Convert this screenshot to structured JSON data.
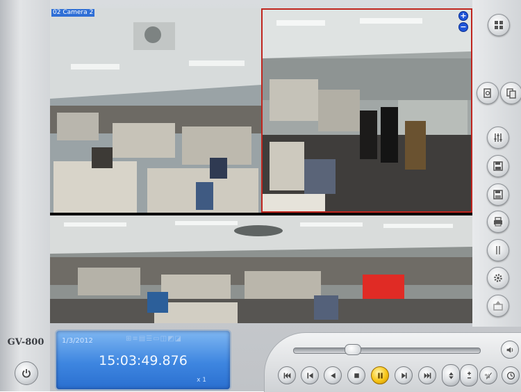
{
  "app": {
    "brand": "GV-800"
  },
  "cameras": [
    {
      "label": "02 Camera 2",
      "selected": false
    },
    {
      "label": "",
      "selected": true
    },
    {
      "label": "",
      "selected": false
    }
  ],
  "zoom": {
    "in_glyph": "+",
    "out_glyph": "−"
  },
  "playback": {
    "date": "1/3/2012",
    "time": "15:03:49.876",
    "speed": "x 1",
    "status_icons": "⊞≡▤☰▭◫◩◪"
  },
  "right_toolbar": [
    {
      "name": "layout-icon"
    },
    {
      "name": "search-icon"
    },
    {
      "name": "copy-icon"
    },
    {
      "name": "adjust-icon"
    },
    {
      "name": "save-avi-icon"
    },
    {
      "name": "save-bmp-icon"
    },
    {
      "name": "print-icon"
    },
    {
      "name": "tools-icon"
    },
    {
      "name": "settings-icon"
    },
    {
      "name": "export-icon"
    }
  ],
  "playback_controls": [
    {
      "name": "skip-first-icon"
    },
    {
      "name": "step-back-icon"
    },
    {
      "name": "rewind-icon"
    },
    {
      "name": "stop-icon"
    },
    {
      "name": "pause-icon"
    },
    {
      "name": "play-icon"
    },
    {
      "name": "skip-last-icon"
    },
    {
      "name": "speed-stepper-icon"
    },
    {
      "name": "frame-stepper-icon"
    },
    {
      "name": "mode-toggle-icon"
    },
    {
      "name": "clock-icon"
    }
  ],
  "seek": {
    "position": 0.32
  },
  "colors": {
    "selected_border": "#c0261f",
    "lcd": "#3e86e0",
    "pause": "#f7c515"
  }
}
